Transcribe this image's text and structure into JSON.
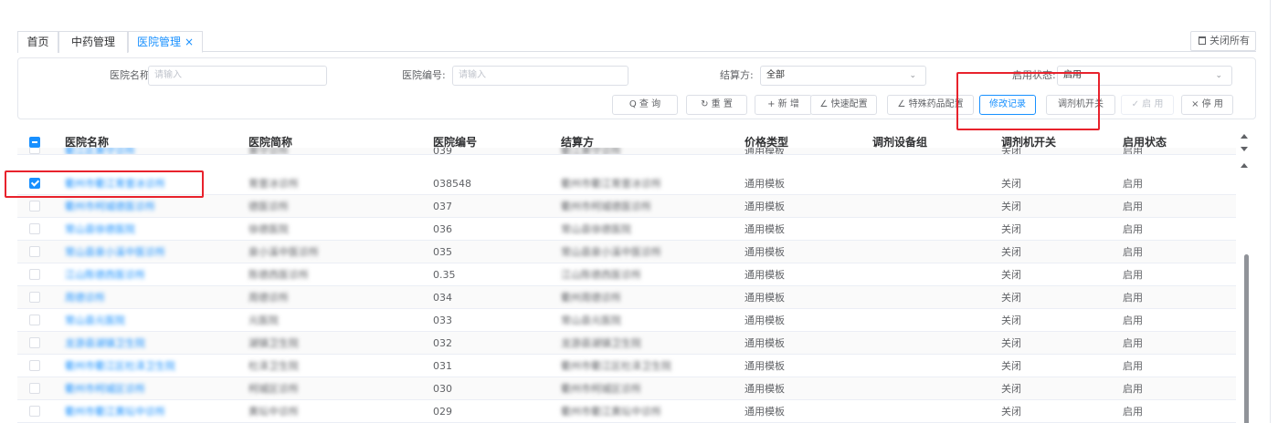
{
  "tabs": {
    "items": [
      {
        "label": "首页"
      },
      {
        "label": "中药管理"
      },
      {
        "label": "医院管理",
        "close": "×"
      }
    ],
    "close_all": "关闭所有"
  },
  "filter": {
    "hospital_name_label": "医院名称:",
    "hospital_name_placeholder": "请输入",
    "hospital_code_label": "医院编号:",
    "hospital_code_placeholder": "请输入",
    "settlement_label": "结算方:",
    "settlement_value": "全部",
    "status_label": "启用状态:",
    "status_value": "启用",
    "caret": "⌄"
  },
  "toolbar": {
    "search": "Q 查 询",
    "reset": "↻ 重 置",
    "add": "+ 新 增",
    "quick_config": "∠ 快速配置",
    "special_drug": "∠ 特殊药品配置",
    "modify_log": "修改记录",
    "dispense_switch": "调剂机开关",
    "enable": "✓ 启 用",
    "disable": "× 停 用"
  },
  "table": {
    "columns": [
      "医院名称",
      "医院简称",
      "医院编号",
      "结算方",
      "价格类型",
      "调剂设备组",
      "调剂机开关",
      "启用状态"
    ],
    "rows": [
      {
        "name": "衢江区黄守诊所",
        "short": "黄守诊所",
        "code": "039",
        "settle": "衢江黄守诊所",
        "price": "通用模板",
        "group": "",
        "switch": "关闭",
        "status": "启用",
        "checked": false
      },
      {
        "name": "衢州市衢江育壹冰诊所",
        "short": "育壹冰诊所",
        "code": "038548",
        "settle": "衢州市衢江育壹冰诊所",
        "price": "通用模板",
        "group": "",
        "switch": "关闭",
        "status": "启用",
        "checked": true
      },
      {
        "name": "衢州市柯城德医诊所",
        "short": "德医诊所",
        "code": "037",
        "settle": "衢州市柯城德医诊所",
        "price": "通用模板",
        "group": "",
        "switch": "关闭",
        "status": "启用",
        "checked": false
      },
      {
        "name": "常山县徐德医院",
        "short": "徐德医院",
        "code": "036",
        "settle": "常山县徐德医院",
        "price": "通用模板",
        "group": "",
        "switch": "关闭",
        "status": "启用",
        "checked": false
      },
      {
        "name": "常山县泉小溪中医诊所",
        "short": "泉小溪中医诊所",
        "code": "035",
        "settle": "常山县泉小溪中医诊所",
        "price": "通用模板",
        "group": "",
        "switch": "关闭",
        "status": "启用",
        "checked": false
      },
      {
        "name": "江山陈德西医诊所",
        "short": "陈德西医诊所",
        "code": "0.35",
        "settle": "江山陈德西医诊所",
        "price": "通用模板",
        "group": "",
        "switch": "关闭",
        "status": "启用",
        "checked": false
      },
      {
        "name": "周德诊所",
        "short": "周德诊所",
        "code": "034",
        "settle": "衢州周德诊所",
        "price": "通用模板",
        "group": "",
        "switch": "关闭",
        "status": "启用",
        "checked": false
      },
      {
        "name": "常山县元医院",
        "short": "元医院",
        "code": "033",
        "settle": "常山县元医院",
        "price": "通用模板",
        "group": "",
        "switch": "关闭",
        "status": "启用",
        "checked": false
      },
      {
        "name": "龙游县湖镇卫生院",
        "short": "湖镇卫生院",
        "code": "032",
        "settle": "龙游县湖镇卫生院",
        "price": "通用模板",
        "group": "",
        "switch": "关闭",
        "status": "启用",
        "checked": false
      },
      {
        "name": "衢州市衢江区杜泽卫生院",
        "short": "杜泽卫生院",
        "code": "031",
        "settle": "衢州市衢江区杜泽卫生院",
        "price": "通用模板",
        "group": "",
        "switch": "关闭",
        "status": "启用",
        "checked": false
      },
      {
        "name": "衢州市柯城区诊所",
        "short": "柯城区诊所",
        "code": "030",
        "settle": "衢州市柯城区诊所",
        "price": "通用模板",
        "group": "",
        "switch": "关闭",
        "status": "启用",
        "checked": false
      },
      {
        "name": "衢州市衢江黄坛中诊所",
        "short": "黄坛中诊所",
        "code": "029",
        "settle": "衢州市衢江黄坛中诊所",
        "price": "通用模板",
        "group": "",
        "switch": "关闭",
        "status": "启用",
        "checked": false
      }
    ]
  },
  "colors": {
    "accent": "#1890ff",
    "highlight": "#e8222c"
  }
}
